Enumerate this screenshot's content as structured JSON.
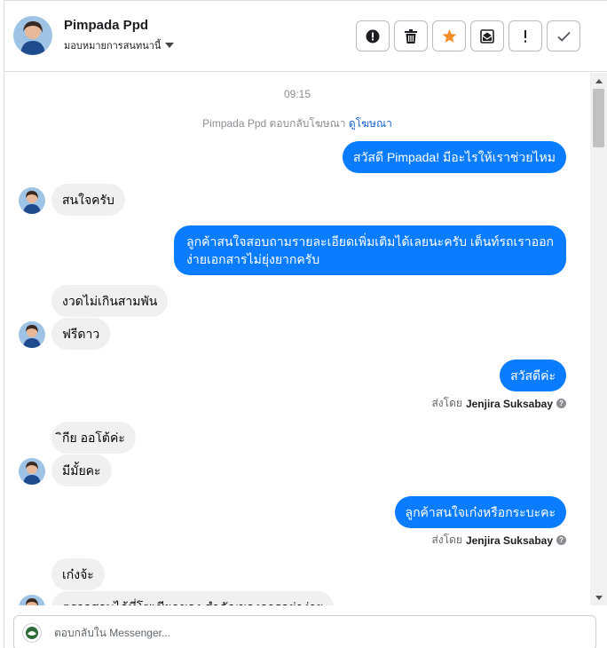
{
  "header": {
    "name": "Pimpada Ppd",
    "assign_label": "มอบหมายการสนทนานี้",
    "actions": [
      "spam-icon",
      "trash-icon",
      "star-icon",
      "mark-unread-icon",
      "important-icon",
      "done-icon"
    ],
    "star_color": "#f28c28"
  },
  "thread": {
    "timestamp": "09:15",
    "ad_note": "Pimpada Ppd ตอบกลับโฆษณา",
    "ad_link": "ดูโฆษณา",
    "messages": [
      {
        "from": "page",
        "text": "สวัสดี Pimpada! มีอะไรให้เราช่วยไหม"
      },
      {
        "from": "user",
        "text": "สนใจครับ"
      },
      {
        "from": "page",
        "lines": [
          "ลูกค้าสนใจสอบถามรายละเอียดเพิ่มเติมได้เลยนะครับ เต็นท์รถเราออก",
          "ง่ายเอกสารไม่ยุ่งยากครับ"
        ]
      },
      {
        "from": "user",
        "text": "งวดไม่เกินสามพัน"
      },
      {
        "from": "user",
        "text": "ฟรีดาว"
      },
      {
        "from": "page",
        "text": "สวัสดีค่ะ"
      },
      {
        "from": "user",
        "text": "ิกีย ออโต้ค่ะ"
      },
      {
        "from": "user",
        "text": "มีมั้ยคะ"
      },
      {
        "from": "page",
        "text": "ลูกค้าสนใจเก๋งหรือกระบะคะ"
      },
      {
        "from": "user",
        "text": "เก๋งจ้ะ"
      },
      {
        "from": "user",
        "text": "ตรวจสอบได้ที่โซเชียลของ สำคัญของการอย่าง่าย"
      }
    ],
    "sent_by_prefix": "ส่งโดย",
    "sent_by_name": "Jenjira Suksabay",
    "outgoing_color": "#0a7cff",
    "incoming_color": "#f0f0f0"
  },
  "reply": {
    "placeholder": "ตอบกลับใน Messenger..."
  }
}
